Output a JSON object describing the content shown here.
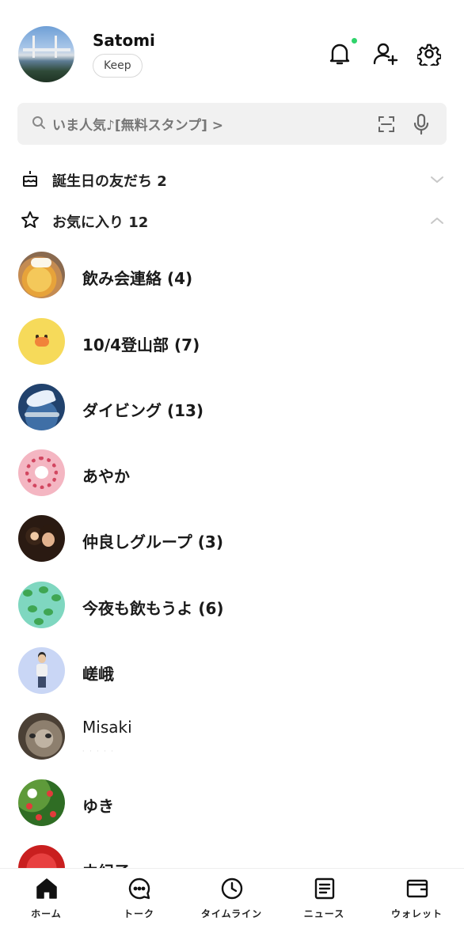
{
  "profile": {
    "name": "Satomi",
    "keep_label": "Keep"
  },
  "header": {
    "notification_icon": "bell-icon",
    "add_friend_icon": "add-friend-icon",
    "settings_icon": "gear-icon",
    "notification_dot_color": "#2fd36b"
  },
  "search": {
    "placeholder": "いま人気♪[無料スタンプ] >"
  },
  "sections": {
    "birthday": {
      "label": "誕生日の友だち 2",
      "icon": "cake-icon",
      "state": "collapsed"
    },
    "favorites": {
      "label": "お気に入り 12",
      "icon": "star-icon",
      "state": "expanded"
    }
  },
  "friends": [
    {
      "name": "飲み会連絡 (4)"
    },
    {
      "name": "10/4登山部 (7)"
    },
    {
      "name": "ダイビング (13)"
    },
    {
      "name": "あやか"
    },
    {
      "name": "仲良しグループ (3)"
    },
    {
      "name": "今夜も飲もうよ (6)"
    },
    {
      "name": "嵯峨"
    },
    {
      "name": "Misaki"
    },
    {
      "name": "ゆき"
    },
    {
      "name": "由紀子"
    }
  ],
  "bottom_nav": [
    {
      "label": "ホーム",
      "icon": "home-icon",
      "active": true
    },
    {
      "label": "トーク",
      "icon": "chat-icon",
      "active": false
    },
    {
      "label": "タイムライン",
      "icon": "clock-icon",
      "active": false
    },
    {
      "label": "ニュース",
      "icon": "news-icon",
      "active": false
    },
    {
      "label": "ウォレット",
      "icon": "wallet-icon",
      "active": false
    }
  ]
}
